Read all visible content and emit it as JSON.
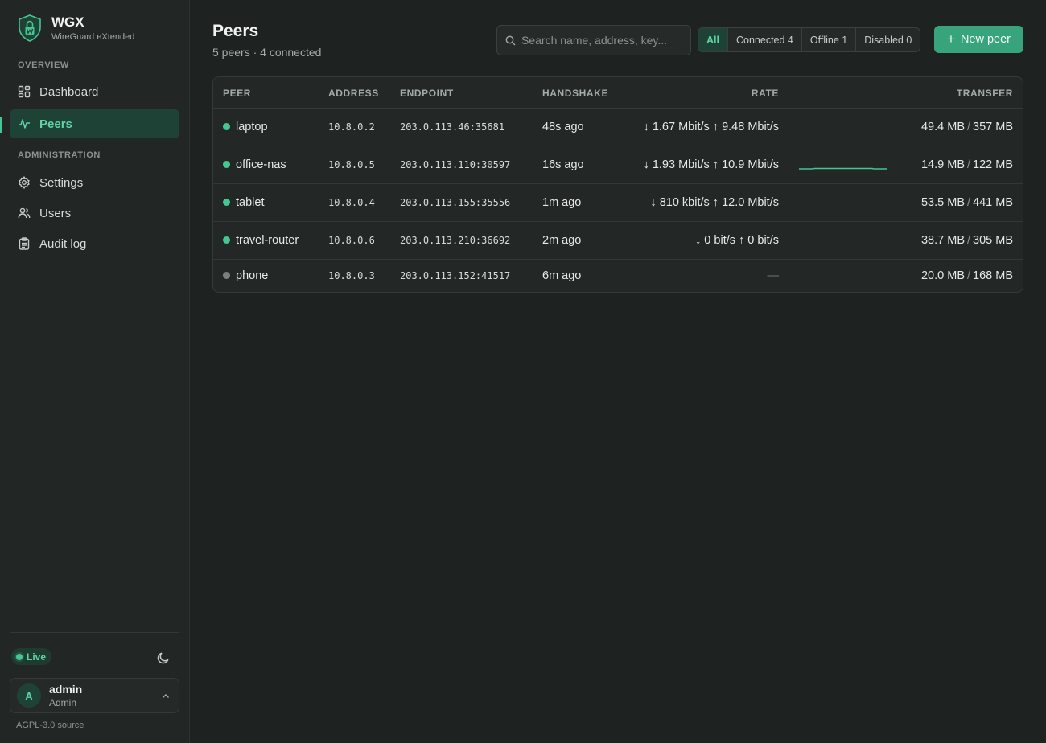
{
  "brand": {
    "title": "WGX",
    "subtitle": "WireGuard eXtended",
    "accent": "#45c692"
  },
  "sidebar": {
    "sections": [
      {
        "label": "OVERVIEW"
      },
      {
        "label": "ADMINISTRATION"
      }
    ],
    "items": [
      {
        "label": "Dashboard",
        "icon": "dashboard-icon",
        "active": false
      },
      {
        "label": "Peers",
        "icon": "activity-icon",
        "active": true
      },
      {
        "label": "Settings",
        "icon": "gear-icon",
        "active": false
      },
      {
        "label": "Users",
        "icon": "users-icon",
        "active": false
      },
      {
        "label": "Audit log",
        "icon": "clipboard-icon",
        "active": false
      }
    ],
    "live_label": "Live",
    "theme_icon": "moon-icon",
    "user": {
      "initial": "A",
      "name": "admin",
      "role": "Admin"
    },
    "source_label": "AGPL-3.0 source"
  },
  "header": {
    "title": "Peers",
    "subtitle": "5 peers · 4 connected",
    "search_placeholder": "Search name, address, key...",
    "filters": [
      {
        "label": "All",
        "active": true
      },
      {
        "label": "Connected 4",
        "active": false
      },
      {
        "label": "Offline 1",
        "active": false
      },
      {
        "label": "Disabled 0",
        "active": false
      }
    ],
    "new_peer_label": "New peer"
  },
  "table": {
    "columns": [
      "PEER",
      "ADDRESS",
      "ENDPOINT",
      "HANDSHAKE",
      "RATE",
      "TRANSFER"
    ],
    "rows": [
      {
        "name": "laptop",
        "online": true,
        "address": "10.8.0.2",
        "endpoint": "203.0.113.46:35681",
        "handshake": "48s ago",
        "rate": "↓ 1.67 Mbit/s ↑ 9.48 Mbit/s",
        "rx": "49.4 MB",
        "tx": "357 MB",
        "sparkline": false
      },
      {
        "name": "office-nas",
        "online": true,
        "address": "10.8.0.5",
        "endpoint": "203.0.113.110:30597",
        "handshake": "16s ago",
        "rate": "↓ 1.93 Mbit/s ↑ 10.9 Mbit/s",
        "rx": "14.9 MB",
        "tx": "122 MB",
        "sparkline": true
      },
      {
        "name": "tablet",
        "online": true,
        "address": "10.8.0.4",
        "endpoint": "203.0.113.155:35556",
        "handshake": "1m ago",
        "rate": "↓ 810 kbit/s ↑ 12.0 Mbit/s",
        "rx": "53.5 MB",
        "tx": "441 MB",
        "sparkline": false
      },
      {
        "name": "travel-router",
        "online": true,
        "address": "10.8.0.6",
        "endpoint": "203.0.113.210:36692",
        "handshake": "2m ago",
        "rate": "↓ 0 bit/s ↑ 0 bit/s",
        "rx": "38.7 MB",
        "tx": "305 MB",
        "sparkline": false
      },
      {
        "name": "phone",
        "online": false,
        "address": "10.8.0.3",
        "endpoint": "203.0.113.152:41517",
        "handshake": "6m ago",
        "rate": "—",
        "rx": "20.0 MB",
        "tx": "168 MB",
        "sparkline": false
      }
    ]
  },
  "colors": {
    "online": "#45c692",
    "offline": "#7a807d"
  }
}
